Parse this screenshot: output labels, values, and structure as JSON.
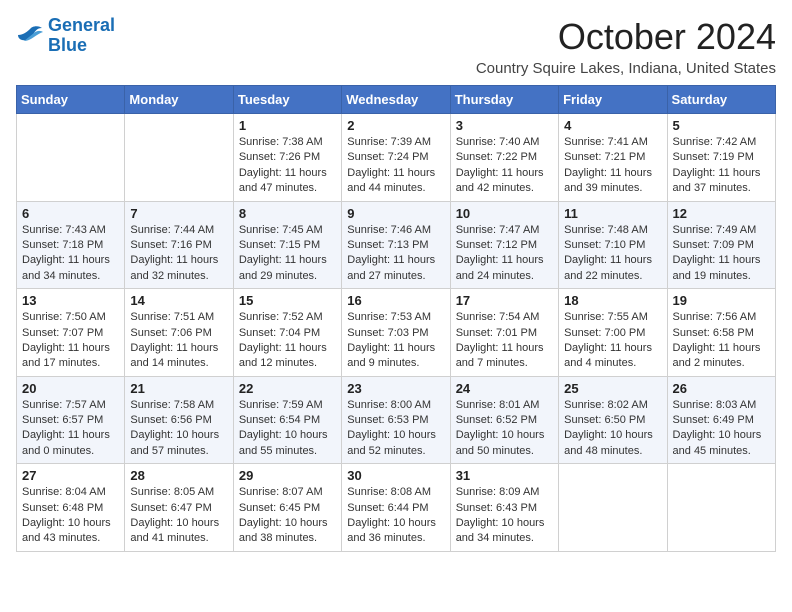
{
  "header": {
    "logo_line1": "General",
    "logo_line2": "Blue",
    "month_title": "October 2024",
    "location": "Country Squire Lakes, Indiana, United States"
  },
  "calendar": {
    "days_of_week": [
      "Sunday",
      "Monday",
      "Tuesday",
      "Wednesday",
      "Thursday",
      "Friday",
      "Saturday"
    ],
    "weeks": [
      [
        {
          "day": "",
          "info": ""
        },
        {
          "day": "",
          "info": ""
        },
        {
          "day": "1",
          "info": "Sunrise: 7:38 AM\nSunset: 7:26 PM\nDaylight: 11 hours and 47 minutes."
        },
        {
          "day": "2",
          "info": "Sunrise: 7:39 AM\nSunset: 7:24 PM\nDaylight: 11 hours and 44 minutes."
        },
        {
          "day": "3",
          "info": "Sunrise: 7:40 AM\nSunset: 7:22 PM\nDaylight: 11 hours and 42 minutes."
        },
        {
          "day": "4",
          "info": "Sunrise: 7:41 AM\nSunset: 7:21 PM\nDaylight: 11 hours and 39 minutes."
        },
        {
          "day": "5",
          "info": "Sunrise: 7:42 AM\nSunset: 7:19 PM\nDaylight: 11 hours and 37 minutes."
        }
      ],
      [
        {
          "day": "6",
          "info": "Sunrise: 7:43 AM\nSunset: 7:18 PM\nDaylight: 11 hours and 34 minutes."
        },
        {
          "day": "7",
          "info": "Sunrise: 7:44 AM\nSunset: 7:16 PM\nDaylight: 11 hours and 32 minutes."
        },
        {
          "day": "8",
          "info": "Sunrise: 7:45 AM\nSunset: 7:15 PM\nDaylight: 11 hours and 29 minutes."
        },
        {
          "day": "9",
          "info": "Sunrise: 7:46 AM\nSunset: 7:13 PM\nDaylight: 11 hours and 27 minutes."
        },
        {
          "day": "10",
          "info": "Sunrise: 7:47 AM\nSunset: 7:12 PM\nDaylight: 11 hours and 24 minutes."
        },
        {
          "day": "11",
          "info": "Sunrise: 7:48 AM\nSunset: 7:10 PM\nDaylight: 11 hours and 22 minutes."
        },
        {
          "day": "12",
          "info": "Sunrise: 7:49 AM\nSunset: 7:09 PM\nDaylight: 11 hours and 19 minutes."
        }
      ],
      [
        {
          "day": "13",
          "info": "Sunrise: 7:50 AM\nSunset: 7:07 PM\nDaylight: 11 hours and 17 minutes."
        },
        {
          "day": "14",
          "info": "Sunrise: 7:51 AM\nSunset: 7:06 PM\nDaylight: 11 hours and 14 minutes."
        },
        {
          "day": "15",
          "info": "Sunrise: 7:52 AM\nSunset: 7:04 PM\nDaylight: 11 hours and 12 minutes."
        },
        {
          "day": "16",
          "info": "Sunrise: 7:53 AM\nSunset: 7:03 PM\nDaylight: 11 hours and 9 minutes."
        },
        {
          "day": "17",
          "info": "Sunrise: 7:54 AM\nSunset: 7:01 PM\nDaylight: 11 hours and 7 minutes."
        },
        {
          "day": "18",
          "info": "Sunrise: 7:55 AM\nSunset: 7:00 PM\nDaylight: 11 hours and 4 minutes."
        },
        {
          "day": "19",
          "info": "Sunrise: 7:56 AM\nSunset: 6:58 PM\nDaylight: 11 hours and 2 minutes."
        }
      ],
      [
        {
          "day": "20",
          "info": "Sunrise: 7:57 AM\nSunset: 6:57 PM\nDaylight: 11 hours and 0 minutes."
        },
        {
          "day": "21",
          "info": "Sunrise: 7:58 AM\nSunset: 6:56 PM\nDaylight: 10 hours and 57 minutes."
        },
        {
          "day": "22",
          "info": "Sunrise: 7:59 AM\nSunset: 6:54 PM\nDaylight: 10 hours and 55 minutes."
        },
        {
          "day": "23",
          "info": "Sunrise: 8:00 AM\nSunset: 6:53 PM\nDaylight: 10 hours and 52 minutes."
        },
        {
          "day": "24",
          "info": "Sunrise: 8:01 AM\nSunset: 6:52 PM\nDaylight: 10 hours and 50 minutes."
        },
        {
          "day": "25",
          "info": "Sunrise: 8:02 AM\nSunset: 6:50 PM\nDaylight: 10 hours and 48 minutes."
        },
        {
          "day": "26",
          "info": "Sunrise: 8:03 AM\nSunset: 6:49 PM\nDaylight: 10 hours and 45 minutes."
        }
      ],
      [
        {
          "day": "27",
          "info": "Sunrise: 8:04 AM\nSunset: 6:48 PM\nDaylight: 10 hours and 43 minutes."
        },
        {
          "day": "28",
          "info": "Sunrise: 8:05 AM\nSunset: 6:47 PM\nDaylight: 10 hours and 41 minutes."
        },
        {
          "day": "29",
          "info": "Sunrise: 8:07 AM\nSunset: 6:45 PM\nDaylight: 10 hours and 38 minutes."
        },
        {
          "day": "30",
          "info": "Sunrise: 8:08 AM\nSunset: 6:44 PM\nDaylight: 10 hours and 36 minutes."
        },
        {
          "day": "31",
          "info": "Sunrise: 8:09 AM\nSunset: 6:43 PM\nDaylight: 10 hours and 34 minutes."
        },
        {
          "day": "",
          "info": ""
        },
        {
          "day": "",
          "info": ""
        }
      ]
    ]
  }
}
